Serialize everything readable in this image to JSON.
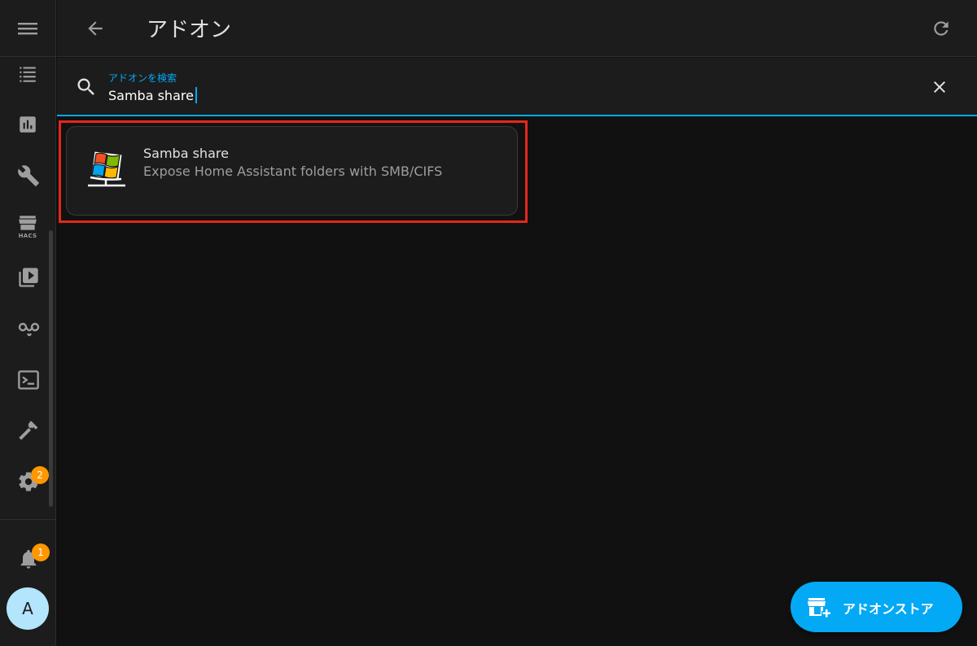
{
  "sidebar": {
    "items": [
      {
        "icon": "format-list-icon"
      },
      {
        "icon": "chart-icon"
      },
      {
        "icon": "wrench-icon"
      },
      {
        "icon": "hacs-store-icon",
        "label": "HACS"
      },
      {
        "icon": "media-play-icon"
      },
      {
        "icon": "graph-network-icon"
      },
      {
        "icon": "terminal-icon"
      },
      {
        "icon": "hammer-icon"
      },
      {
        "icon": "gear-icon",
        "badge": "2"
      }
    ],
    "notifications": {
      "icon": "bell-icon",
      "badge": "1"
    },
    "user": {
      "avatar_letter": "A"
    }
  },
  "header": {
    "title": "アドオン"
  },
  "search": {
    "label": "アドオンを検索",
    "value": "Samba share"
  },
  "results": [
    {
      "name": "Samba share",
      "description": "Expose Home Assistant folders with SMB/CIFS",
      "logo": "windows-share-logo"
    }
  ],
  "fab": {
    "label": "アドオンストア",
    "icon": "store-plus-icon"
  },
  "colors": {
    "accent": "#03a9f4",
    "badge": "#ff9800",
    "highlight": "#e3281b",
    "background": "#111111",
    "surface": "#1c1c1c"
  }
}
